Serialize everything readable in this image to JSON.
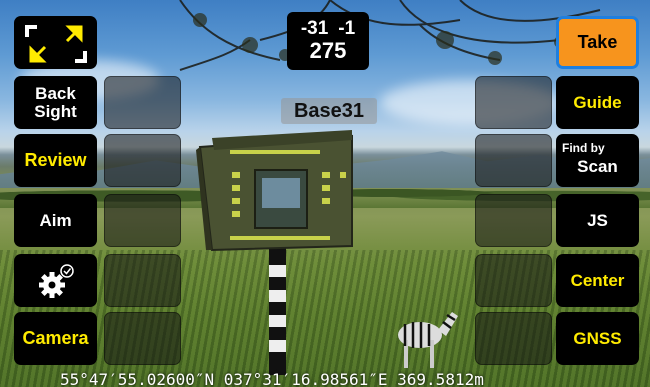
{
  "readout": {
    "value_a": "-31",
    "value_b": "-1",
    "value_c": "275"
  },
  "target_label": "Base31",
  "left_buttons": [
    {
      "line1": "Back",
      "line2": "Sight"
    },
    {
      "label": "Review"
    },
    {
      "label": "Aim"
    },
    {
      "icon": "settings-gear-check-icon"
    },
    {
      "label": "Camera"
    }
  ],
  "right_buttons": {
    "take": "Take",
    "guide": "Guide",
    "find_by_small": "Find by",
    "find_by_big": "Scan",
    "js": "JS",
    "center": "Center",
    "gnss": "GNSS"
  },
  "coordinates": "55°47′55.02600″N 037°31′16.98561″E 369.5812m",
  "colors": {
    "accent_yellow": "#ffeb00",
    "take_orange": "#f7941d",
    "take_border": "#1e7fe0"
  },
  "icons": {
    "fullscreen": "fullscreen-toggle-icon",
    "settings": "settings-gear-check-icon"
  }
}
